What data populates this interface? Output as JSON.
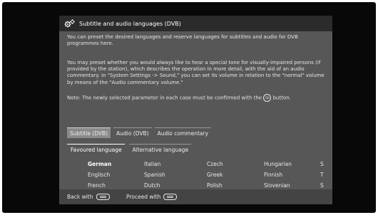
{
  "dialog": {
    "title": "Subtitle and audio languages (DVB)",
    "icon": "gears-icon"
  },
  "text": {
    "intro": "You can preset the desired languages and reserve languages for subtitles and audio for DVB programmes here.",
    "commentary": "You may preset whether you would always like to hear a special tone for visually-impaired persons (if provided by the station), which describes the operation in more detail, with the aid of an audio commentary. In \"System Settings -> Sound,\" you can set its volume in relation to the \"normal\" volume by means of the \"Audio commentary volume.\"",
    "note_before": "Note: The newly selected parameter in each case must be confirmed with the",
    "note_icon": "OK",
    "note_after": "button."
  },
  "tabs": [
    "Subtitle (DVB)",
    "Audio (DVB)",
    "Audio commentary"
  ],
  "subtabs": [
    "Favoured language",
    "Alternative language"
  ],
  "languages": [
    [
      "German",
      "Italian",
      "Czech",
      "Hungarian",
      "S"
    ],
    [
      "Englisch",
      "Spanish",
      "Greek",
      "Finnish",
      "T"
    ],
    [
      "French",
      "Dutch",
      "Polish",
      "Slovenian",
      "S"
    ]
  ],
  "footer": {
    "back": "Back with",
    "proceed": "Proceed with"
  },
  "colors": {
    "panel": "#575757",
    "titlebar": "#2b2b2b",
    "active_tab": "#8a8a8a",
    "footer": "#444444",
    "screen": "#080808"
  }
}
